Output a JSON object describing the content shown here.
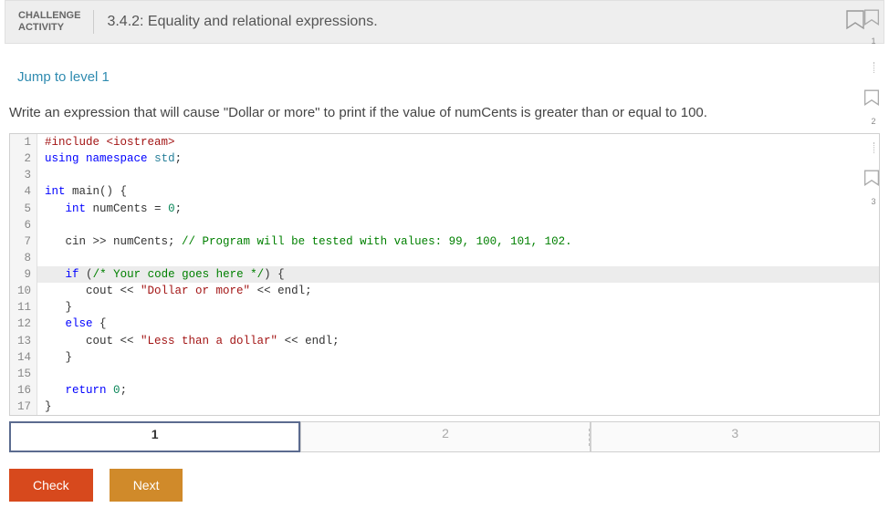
{
  "header": {
    "tag_line1": "CHALLENGE",
    "tag_line2": "ACTIVITY",
    "title": "3.4.2: Equality and relational expressions."
  },
  "jump_label": "Jump to level 1",
  "prompt": "Write an expression that will cause \"Dollar or more\" to print if the value of numCents is greater than or equal to 100.",
  "code": {
    "lines": [
      {
        "n": "1",
        "hl": false,
        "tokens": [
          [
            "pp",
            "#include <iostream>"
          ]
        ]
      },
      {
        "n": "2",
        "hl": false,
        "tokens": [
          [
            "key",
            "using"
          ],
          [
            "",
            ""
          ],
          [
            "key",
            "namespace"
          ],
          [
            "",
            ""
          ],
          [
            "type",
            "std"
          ],
          [
            "id",
            ";"
          ]
        ]
      },
      {
        "n": "3",
        "hl": false,
        "tokens": []
      },
      {
        "n": "4",
        "hl": false,
        "tokens": [
          [
            "key",
            "int"
          ],
          [
            "",
            ""
          ],
          [
            "id",
            "main() {"
          ]
        ]
      },
      {
        "n": "5",
        "hl": false,
        "tokens": [
          [
            "",
            "   "
          ],
          [
            "key",
            "int"
          ],
          [
            "",
            ""
          ],
          [
            "id",
            "numCents = "
          ],
          [
            "num",
            "0"
          ],
          [
            "id",
            ";"
          ]
        ]
      },
      {
        "n": "6",
        "hl": false,
        "tokens": []
      },
      {
        "n": "7",
        "hl": false,
        "tokens": [
          [
            "",
            "   "
          ],
          [
            "id",
            "cin >> numCents; "
          ],
          [
            "cmt",
            "// Program will be tested with values: 99, 100, 101, 102."
          ]
        ]
      },
      {
        "n": "8",
        "hl": false,
        "tokens": []
      },
      {
        "n": "9",
        "hl": true,
        "tokens": [
          [
            "",
            "   "
          ],
          [
            "key",
            "if"
          ],
          [
            "",
            ""
          ],
          [
            "id",
            "("
          ],
          [
            "cmt",
            "/* Your code goes here */"
          ],
          [
            "id",
            ") {"
          ]
        ]
      },
      {
        "n": "10",
        "hl": false,
        "tokens": [
          [
            "",
            "      "
          ],
          [
            "id",
            "cout << "
          ],
          [
            "str",
            "\"Dollar or more\""
          ],
          [
            "",
            ""
          ],
          [
            "id",
            "<< endl;"
          ]
        ]
      },
      {
        "n": "11",
        "hl": false,
        "tokens": [
          [
            "",
            "   "
          ],
          [
            "id",
            "}"
          ]
        ]
      },
      {
        "n": "12",
        "hl": false,
        "tokens": [
          [
            "",
            "   "
          ],
          [
            "key",
            "else"
          ],
          [
            "",
            ""
          ],
          [
            "id",
            "{"
          ]
        ]
      },
      {
        "n": "13",
        "hl": false,
        "tokens": [
          [
            "",
            "      "
          ],
          [
            "id",
            "cout << "
          ],
          [
            "str",
            "\"Less than a dollar\""
          ],
          [
            "",
            ""
          ],
          [
            "id",
            "<< endl;"
          ]
        ]
      },
      {
        "n": "14",
        "hl": false,
        "tokens": [
          [
            "",
            "   "
          ],
          [
            "id",
            "}"
          ]
        ]
      },
      {
        "n": "15",
        "hl": false,
        "tokens": []
      },
      {
        "n": "16",
        "hl": false,
        "tokens": [
          [
            "",
            "   "
          ],
          [
            "key",
            "return"
          ],
          [
            "",
            ""
          ],
          [
            "num",
            "0"
          ],
          [
            "id",
            ";"
          ]
        ]
      },
      {
        "n": "17",
        "hl": false,
        "tokens": [
          [
            "id",
            "}"
          ]
        ]
      }
    ]
  },
  "tabs": [
    {
      "label": "1",
      "active": true
    },
    {
      "label": "2",
      "active": false
    },
    {
      "label": "3",
      "active": false
    }
  ],
  "buttons": {
    "check": "Check",
    "next": "Next"
  },
  "rail": [
    {
      "num": "1"
    },
    {
      "num": "2"
    },
    {
      "num": "3"
    }
  ]
}
